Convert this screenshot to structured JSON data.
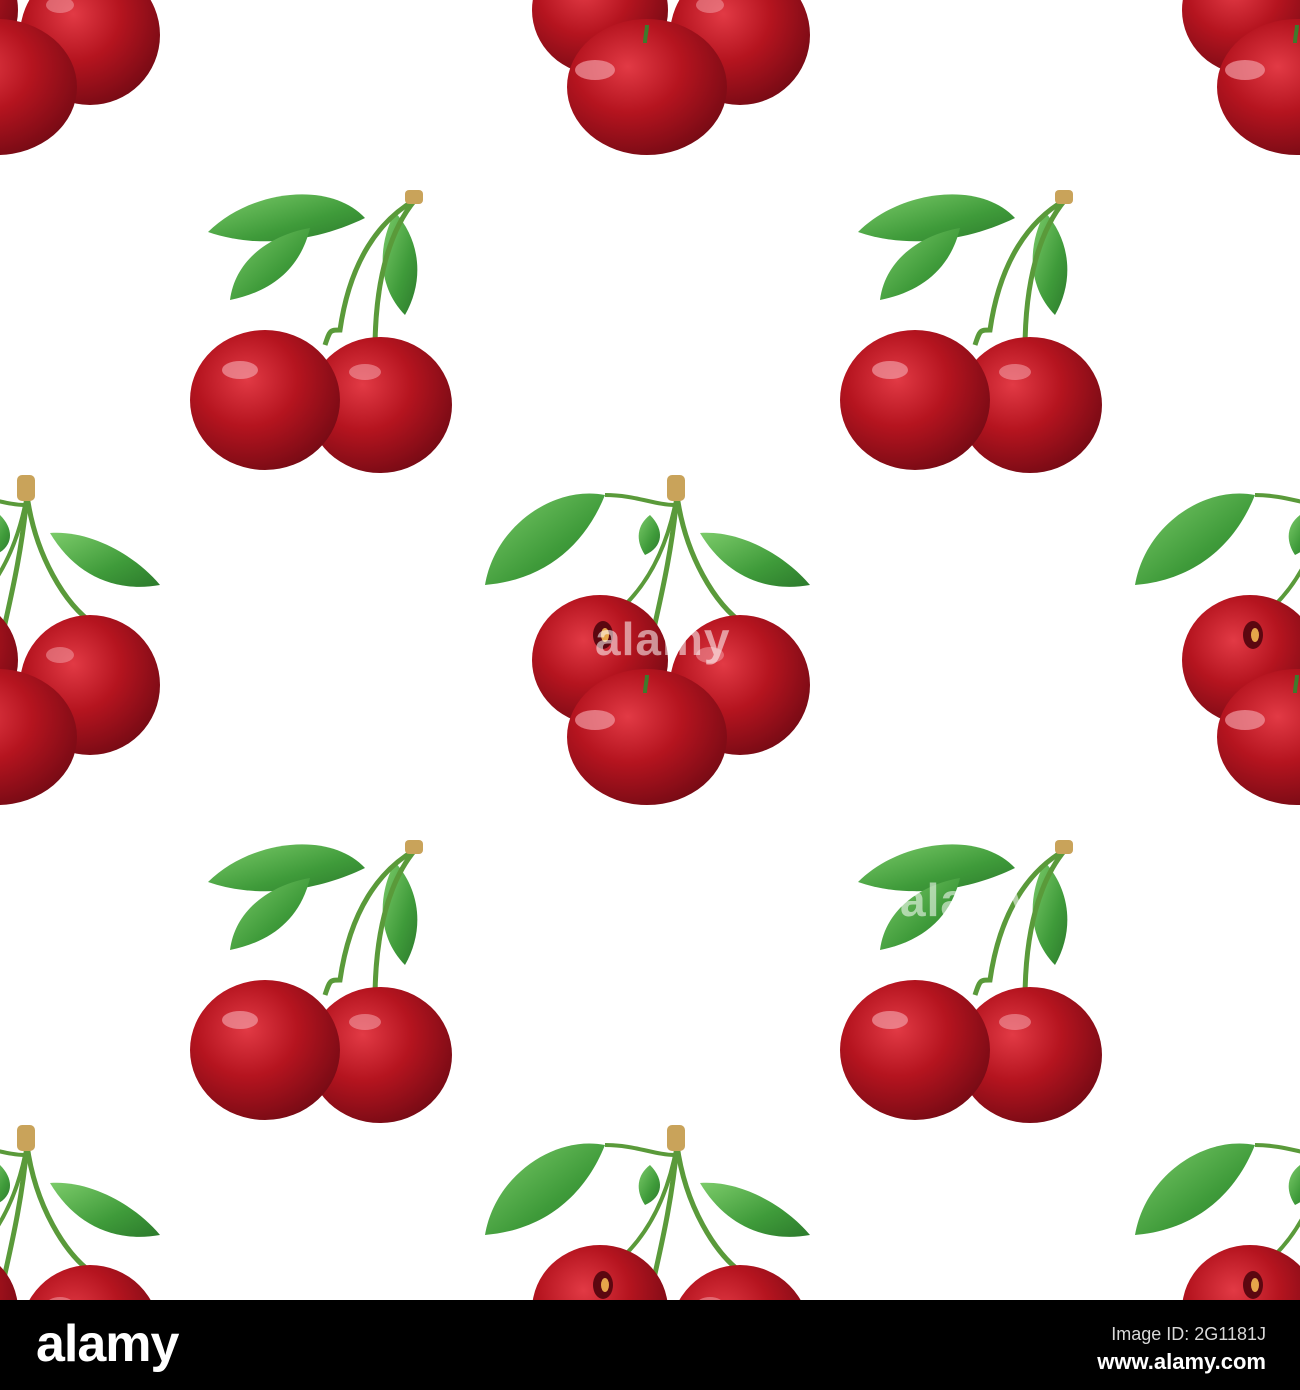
{
  "footer": {
    "logo": "alamy",
    "image_id_label": "Image ID:",
    "image_id": "2G1181J",
    "site": "www.alamy.com"
  },
  "watermark": {
    "text": "alamy"
  },
  "colors": {
    "background": "#ffffff",
    "cherry_red": "#b5141f",
    "cherry_dark": "#6e0913",
    "leaf_green": "#3f9b3a",
    "stem_green": "#5a9a3a",
    "footer_bg": "#000000"
  }
}
